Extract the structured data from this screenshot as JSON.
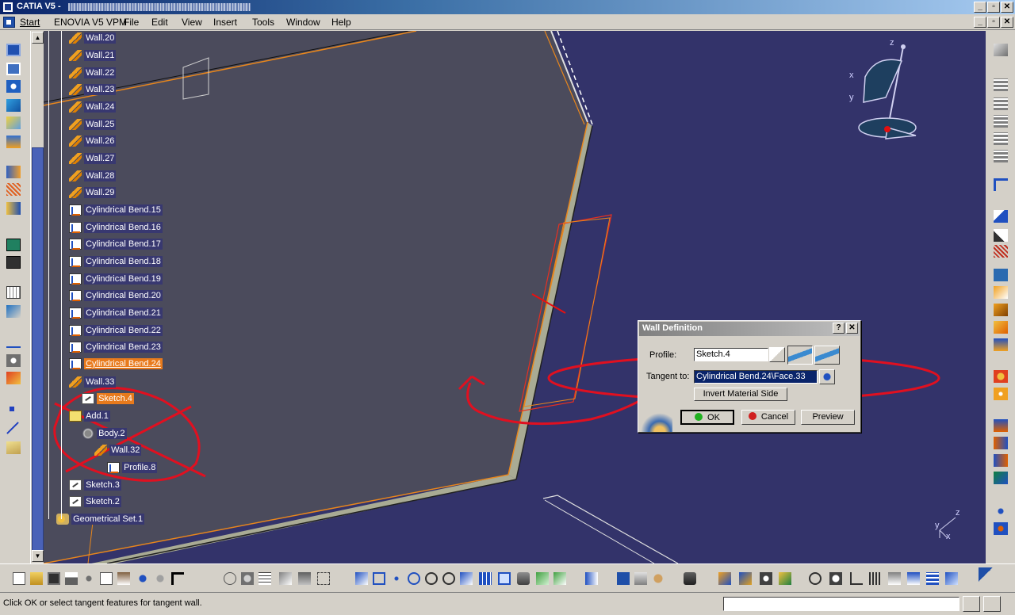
{
  "window": {
    "title": "CATIA V5 -",
    "controls": {
      "minimize": "_",
      "restore": "▫",
      "close": "✕"
    },
    "doc_controls": {
      "minimize": "_",
      "restore": "▫",
      "close": "✕"
    }
  },
  "menu": {
    "items": [
      "Start",
      "ENOVIA V5 VPM",
      "File",
      "Edit",
      "View",
      "Insert",
      "Tools",
      "Window",
      "Help"
    ]
  },
  "tree": {
    "items": [
      {
        "label": "Wall.20",
        "icon": "wall-icon"
      },
      {
        "label": "Wall.21",
        "icon": "wall-icon"
      },
      {
        "label": "Wall.22",
        "icon": "wall-icon"
      },
      {
        "label": "Wall.23",
        "icon": "wall-icon"
      },
      {
        "label": "Wall.24",
        "icon": "wall-icon"
      },
      {
        "label": "Wall.25",
        "icon": "wall-icon"
      },
      {
        "label": "Wall.26",
        "icon": "wall-icon"
      },
      {
        "label": "Wall.27",
        "icon": "wall-icon"
      },
      {
        "label": "Wall.28",
        "icon": "wall-icon"
      },
      {
        "label": "Wall.29",
        "icon": "wall-icon"
      },
      {
        "label": "Cylindrical Bend.15",
        "icon": "bend-icon"
      },
      {
        "label": "Cylindrical Bend.16",
        "icon": "bend-icon"
      },
      {
        "label": "Cylindrical Bend.17",
        "icon": "bend-icon"
      },
      {
        "label": "Cylindrical Bend.18",
        "icon": "bend-icon"
      },
      {
        "label": "Cylindrical Bend.19",
        "icon": "bend-icon"
      },
      {
        "label": "Cylindrical Bend.20",
        "icon": "bend-icon"
      },
      {
        "label": "Cylindrical Bend.21",
        "icon": "bend-icon"
      },
      {
        "label": "Cylindrical Bend.22",
        "icon": "bend-icon"
      },
      {
        "label": "Cylindrical Bend.23",
        "icon": "bend-icon"
      },
      {
        "label": "Cylindrical Bend.24",
        "icon": "bend-icon",
        "selected": true
      },
      {
        "label": "Wall.33",
        "icon": "wall-icon"
      },
      {
        "label": "Sketch.4",
        "icon": "sketch-icon",
        "selected": true
      },
      {
        "label": "Add.1",
        "icon": "add-icon"
      },
      {
        "label": "Body.2",
        "icon": "body-icon"
      },
      {
        "label": "Wall.32",
        "icon": "wall-icon"
      },
      {
        "label": "Profile.8",
        "icon": "profile-icon"
      },
      {
        "label": "Sketch.3",
        "icon": "sketch-icon"
      },
      {
        "label": "Sketch.2",
        "icon": "sketch-icon"
      },
      {
        "label": "Geometrical Set.1",
        "icon": "geometrical-set-icon"
      }
    ]
  },
  "compass": {
    "z": "z",
    "x": "x",
    "y": "y"
  },
  "mini_axis": {
    "z": "z",
    "y": "y",
    "x": "x"
  },
  "dialog": {
    "title": "Wall Definition",
    "help": "?",
    "close": "✕",
    "profile_label": "Profile:",
    "profile_value": "Sketch.4",
    "tangent_label": "Tangent to:",
    "tangent_value": "Cylindrical Bend.24\\Face.33",
    "invert_button": "Invert Material Side",
    "ok_button": "OK",
    "cancel_button": "Cancel",
    "preview_button": "Preview"
  },
  "status": {
    "message": "Click OK or select tangent features for tangent wall.",
    "command_input": ""
  },
  "colors": {
    "viewer_bg": "#33336a",
    "selection": "#e87a1c",
    "annotation_red": "#e01020"
  }
}
